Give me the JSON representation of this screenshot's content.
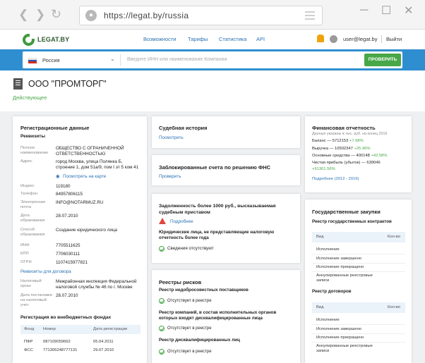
{
  "browser": {
    "url": "https://legat.by/russia"
  },
  "header": {
    "logo_text": "LEGAT.BY",
    "nav": [
      "Возможности",
      "Тарифы",
      "Статистика",
      "API"
    ],
    "user_email": "user@legat.by",
    "logout": "Выйти"
  },
  "search": {
    "country": "Россия",
    "placeholder": "Введите ИНН или наименование Компании",
    "button": "ПРОВЕРИТЬ"
  },
  "company": {
    "name": "ООО \"ПРОМТОРГ\"",
    "status": "Действующее"
  },
  "registration": {
    "title": "Регистрационные данные",
    "requisites_title": "Реквизиты",
    "full_name_label": "Полное наименование",
    "full_name": "ОБЩЕСТВО С ОГРАНИЧЕННОЙ ОТВЕТСТВЕННОСТЬЮ",
    "address_label": "Адрес",
    "address": "город Москва, улица Полянка Б, строение 1, дом 51а/9, пом I эт 5 ком 41",
    "map_link": "Посмотреть на карте",
    "index_label": "Индекс",
    "index": "119180",
    "phone_label": "Телефон",
    "phone": "84957806115",
    "email_label": "Электронная почта",
    "email": "INFO@NOTARMUZ.RU",
    "reg_date_label": "Дата образования",
    "reg_date": "28.07.2010",
    "method_label": "Способ образования",
    "method": "Создание юридического лица",
    "inn_label": "ИНН",
    "inn": "7705511625",
    "kpp_label": "КПП",
    "kpp": "7706030111",
    "ogrn_label": "ОГРН",
    "ogrn": "1107415977821",
    "contract_link": "Реквизиты для договора",
    "tax_label": "Налоговый орган",
    "tax": "Межрайонная инспекция Федеральной налоговой службы № 46 по г. Москве",
    "tax_date_label": "Дата постановки на налоговый учет",
    "tax_date": "28.07.2010",
    "funds_title": "Регистрация во внебюджетных фондах",
    "funds_headers": [
      "Фонд",
      "Номер",
      "Дата регистрации"
    ],
    "funds_rows": [
      [
        "ПФР",
        "087109059662",
        "05.04.2011"
      ],
      [
        "ФСС",
        "771305248777131",
        "29.07.2010"
      ]
    ]
  },
  "court": {
    "title": "Судебная история",
    "link": "Посмотреть"
  },
  "blocked": {
    "title": "Заблокированные счета по решению ФНС",
    "link": "Проверить"
  },
  "debt": {
    "title": "Задолженность более 1000 руб., высказываемая судебным приставом",
    "more": "Подробнее",
    "subtitle": "Юридические лица, не представляющие налоговую отчетность более года",
    "status": "Сведения отсутствуют"
  },
  "risks": {
    "title": "Реестры рисков",
    "items": [
      {
        "name": "Реестр недобросовестных поставщиков",
        "status": "Отсутствует в реестре"
      },
      {
        "name": "Реестр компаний, в состав исполнительных органов которых входят дисквалифицированные лица",
        "status": "Отсутствует в реестре"
      },
      {
        "name": "Реестр дисквалифицированных лиц",
        "status": "Отсутствует в реестре"
      }
    ]
  },
  "finance": {
    "title": "Финансовая отчетность",
    "note": "Данные указаны в тыс. руб. на конец 2016",
    "rows": [
      {
        "label": "Баланс",
        "value": "5712153",
        "delta": "+7.68%"
      },
      {
        "label": "Выручка",
        "value": "10502347",
        "delta": "+25.46%"
      },
      {
        "label": "Основные средства",
        "value": "400148",
        "delta": "+42.58%"
      },
      {
        "label": "Чистая прибыль (убыток)",
        "value": "639046",
        "delta": "+91361.56%"
      }
    ],
    "more": "Подробнее (2012 - 2016)"
  },
  "procurement": {
    "title": "Государственные закупки",
    "contracts_title": "Реестр государственных контрактов",
    "contracts_headers": [
      "Вид",
      "Кол-во"
    ],
    "contracts_rows": [
      "Исполнение",
      "Исполнение завершено",
      "Исполнение прекращено",
      "Аннулированные реестровые записи"
    ],
    "agreements_title": "Реестр договоров",
    "agreements_headers": [
      "Вид",
      "Кол-во"
    ],
    "agreements_rows": [
      "Исполнение",
      "Исполнение завершено",
      "Исполнение прекращено",
      "Аннулированные реестровые записи"
    ]
  },
  "colors": {
    "accent": "#2f8ed0",
    "brand_green": "#48a748",
    "link": "#2a72b5",
    "warn": "#e0453b"
  }
}
